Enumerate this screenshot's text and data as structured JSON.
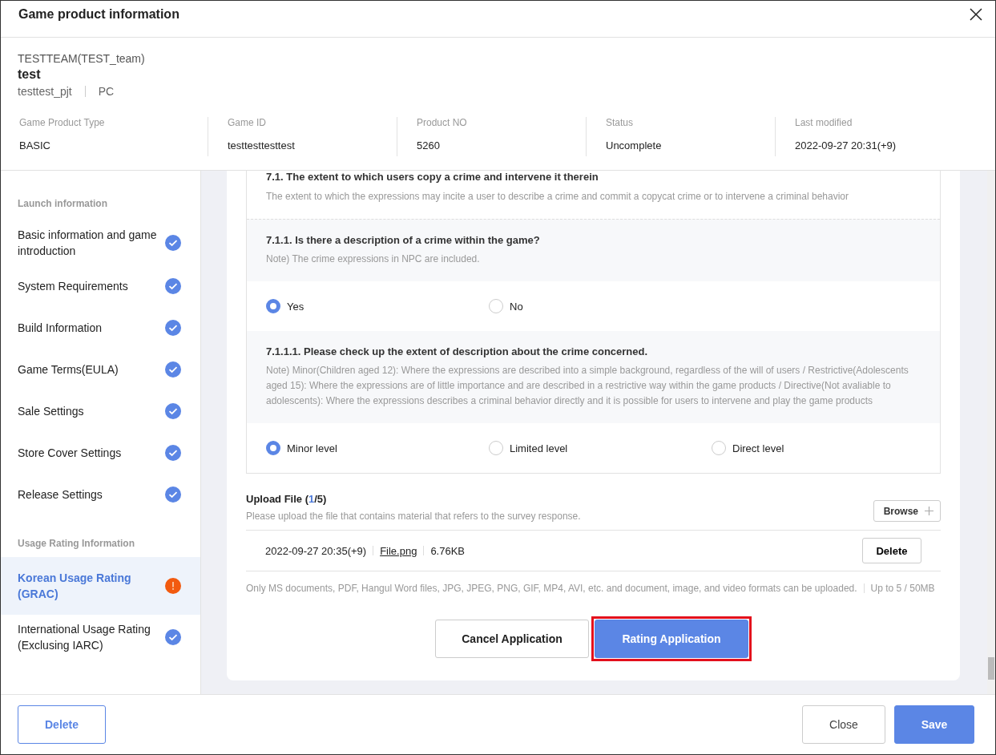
{
  "window": {
    "title": "Game product information"
  },
  "product": {
    "team": "TESTTEAM(TEST_team)",
    "name": "test",
    "project": "testtest_pjt",
    "platform": "PC"
  },
  "summary": [
    {
      "label": "Game Product Type",
      "value": "BASIC"
    },
    {
      "label": "Game ID",
      "value": "testtesttesttest"
    },
    {
      "label": "Product NO",
      "value": "5260"
    },
    {
      "label": "Status",
      "value": "Uncomplete"
    },
    {
      "label": "Last modified",
      "value": "2022-09-27 20:31(+9)"
    }
  ],
  "sidebar": {
    "sections": [
      {
        "title": "Launch information",
        "items": [
          {
            "label": "Basic information and game introduction",
            "kind": "complete",
            "selected": false
          },
          {
            "label": "System Requirements",
            "kind": "complete",
            "selected": false
          },
          {
            "label": "Build Information",
            "kind": "complete",
            "selected": false
          },
          {
            "label": "Game Terms(EULA)",
            "kind": "complete",
            "selected": false
          },
          {
            "label": "Sale Settings",
            "kind": "complete",
            "selected": false
          },
          {
            "label": "Store Cover Settings",
            "kind": "complete",
            "selected": false
          },
          {
            "label": "Release Settings",
            "kind": "complete",
            "selected": false
          }
        ]
      },
      {
        "title": "Usage Rating Information",
        "items": [
          {
            "label": "Korean Usage Rating (GRAC)",
            "kind": "warning",
            "selected": true
          },
          {
            "label": "International Usage Rating (Exclusing IARC)",
            "kind": "complete",
            "selected": false
          }
        ]
      }
    ]
  },
  "criterion": {
    "title": "7.1. The extent to which users copy a crime and intervene it therein",
    "description": "The extent to which the expressions may incite a user to describe a crime and commit a copycat crime or to intervene a criminal behavior"
  },
  "questions": [
    {
      "title": "7.1.1. Is there a description of a crime within the game?",
      "note": "Note) The crime expressions in NPC are included.",
      "options": [
        {
          "label": "Yes",
          "selected": true
        },
        {
          "label": "No",
          "selected": false
        }
      ]
    },
    {
      "title": "7.1.1.1. Please check up the extent of description about the crime concerned.",
      "note": "Note) Minor(Children aged 12): Where the expressions are described into a simple background, regardless of the will of users / Restrictive(Adolescents aged 15): Where the expressions are of little importance and are described in a restrictive way within the game products / Directive(Not avaliable to adolescents): Where the expressions describes a criminal behavior directly and it is possible for users to intervene and play the game products",
      "options": [
        {
          "label": "Minor level",
          "selected": true
        },
        {
          "label": "Limited level",
          "selected": false
        },
        {
          "label": "Direct level",
          "selected": false
        }
      ]
    }
  ],
  "upload": {
    "title": "Upload File (",
    "count": "1",
    "limit": "/5)",
    "description": "Please upload the file that contains material that refers to the survey response.",
    "browse": "Browse",
    "files": [
      {
        "date": "2022-09-27 20:35(+9)",
        "name": "File.png",
        "size": "6.76KB",
        "delete": "Delete"
      }
    ],
    "notice": "Only MS documents, PDF, Hangul Word files, JPG, JPEG, PNG, GIF, MP4, AVI, etc. and document, image, and video formats can be uploaded.",
    "limit_note": "Up to 5 / 50MB"
  },
  "actions": [
    {
      "label": "Cancel Application",
      "kind": "secondary",
      "highlighted": false
    },
    {
      "label": "Rating Application",
      "kind": "primary",
      "highlighted": true
    }
  ],
  "footer": {
    "left": [
      {
        "label": "Delete",
        "kind": "outline"
      }
    ],
    "right": [
      {
        "label": "Close",
        "kind": "secondary"
      },
      {
        "label": "Save",
        "kind": "primary"
      }
    ]
  }
}
